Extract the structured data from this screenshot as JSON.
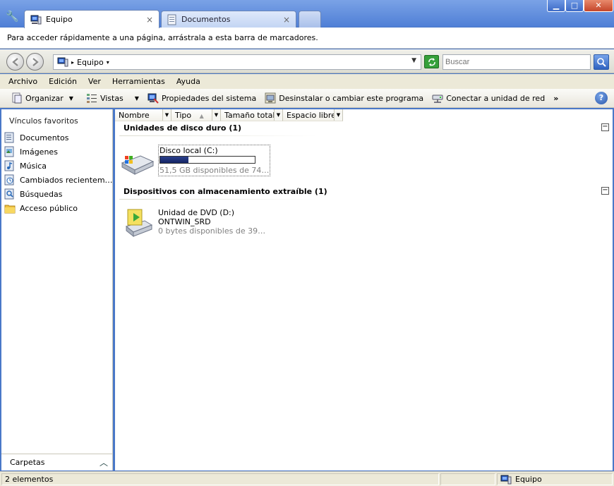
{
  "tabs": [
    {
      "label": "Equipo",
      "close": "×",
      "active": true
    },
    {
      "label": "Documentos",
      "close": "×",
      "active": false
    }
  ],
  "window_controls": {
    "minimize": "▁",
    "maximize": "□",
    "close": "✕"
  },
  "bookmark_bar": {
    "text": "Para acceder rápidamente a una página, arrástrala a esta barra de marcadores."
  },
  "address": {
    "location": "Equipo",
    "search_placeholder": "Buscar"
  },
  "menu": [
    "Archivo",
    "Edición",
    "Ver",
    "Herramientas",
    "Ayuda"
  ],
  "commands": [
    {
      "label": "Organizar",
      "icon": "organize-icon",
      "dropdown": true
    },
    {
      "label": "Vistas",
      "icon": "views-icon",
      "dropdown": true
    },
    {
      "label": "Propiedades del sistema",
      "icon": "system-properties-icon",
      "dropdown": false
    },
    {
      "label": "Desinstalar o cambiar este programa",
      "icon": "uninstall-icon",
      "dropdown": false
    },
    {
      "label": "Conectar a unidad de red",
      "icon": "network-drive-icon",
      "dropdown": false
    }
  ],
  "commands_overflow": "»",
  "navpane": {
    "heading": "Vínculos favoritos",
    "items": [
      {
        "label": "Documentos",
        "icon": "documents-icon"
      },
      {
        "label": "Imágenes",
        "icon": "pictures-icon"
      },
      {
        "label": "Música",
        "icon": "music-icon"
      },
      {
        "label": "Cambiados recientem…",
        "icon": "recent-icon"
      },
      {
        "label": "Búsquedas",
        "icon": "searches-icon"
      },
      {
        "label": "Acceso público",
        "icon": "public-folder-icon"
      }
    ],
    "folders": "Carpetas"
  },
  "columns": [
    "Nombre",
    "Tipo",
    "Tamaño total",
    "Espacio libre"
  ],
  "groups": [
    {
      "title": "Unidades de disco duro (1)",
      "items": [
        {
          "name": "Disco local (C:)",
          "detail": "51,5 GB disponibles de 74…",
          "used_fraction": 0.3,
          "icon": "hard-drive-icon"
        }
      ]
    },
    {
      "title": "Dispositivos con almacenamiento extraíble (1)",
      "items": [
        {
          "name": "Unidad de DVD (D:)",
          "label": "ONTWIN_SRD",
          "detail": "0 bytes disponibles de 39…",
          "icon": "dvd-drive-icon"
        }
      ]
    }
  ],
  "status": {
    "items": "2 elementos",
    "location": "Equipo"
  },
  "colors": {
    "accent": "#4a78c8",
    "capacity_bar": "#1c2f78"
  }
}
